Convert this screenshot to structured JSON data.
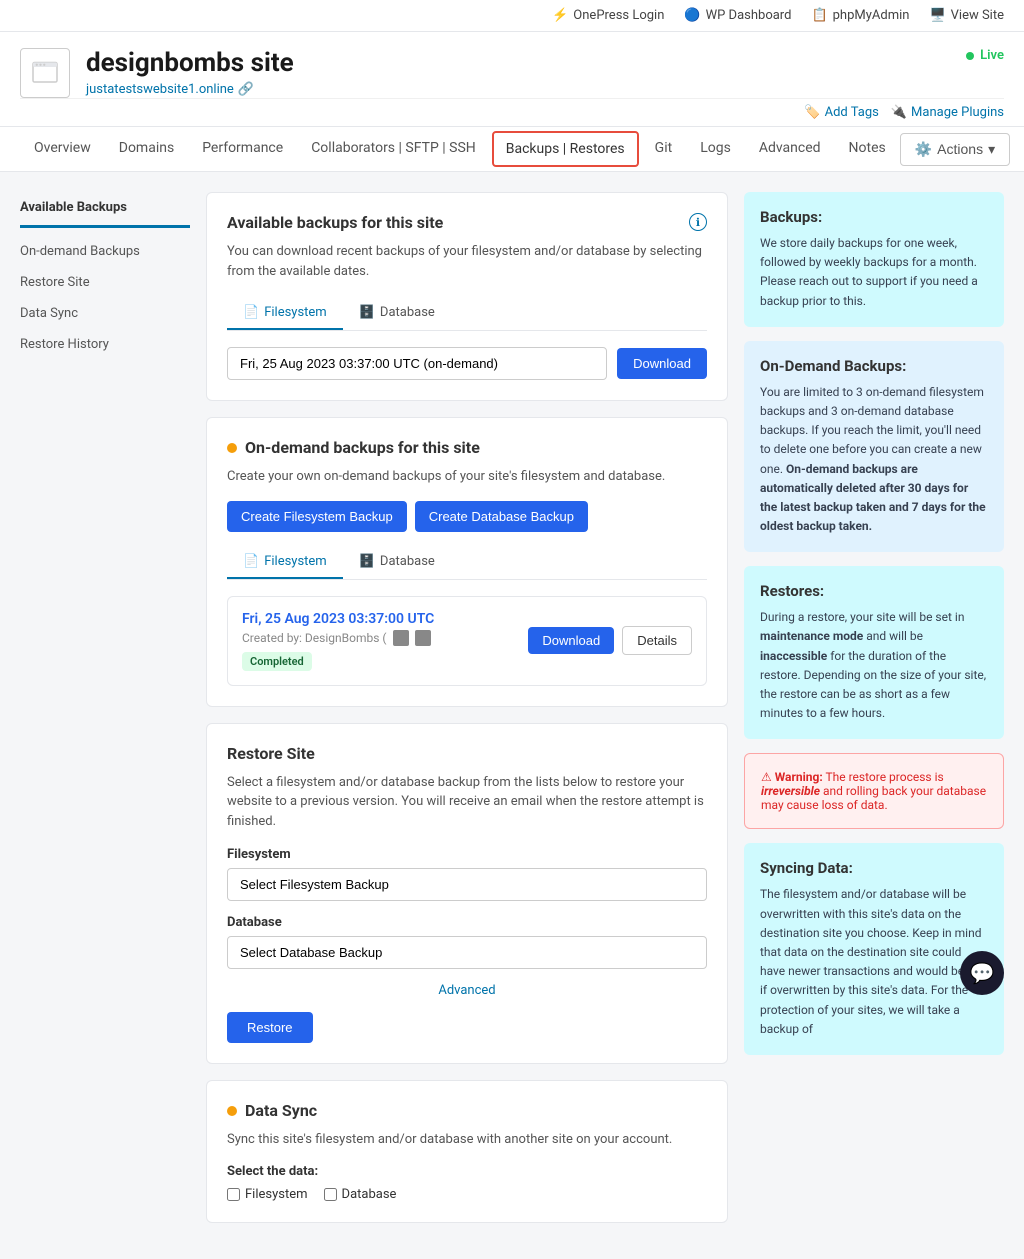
{
  "topbar": {
    "items": [
      {
        "id": "onepress-login",
        "label": "OnePress Login",
        "icon": "⚡"
      },
      {
        "id": "wp-dashboard",
        "label": "WP Dashboard",
        "icon": "🔵"
      },
      {
        "id": "phpmyadmin",
        "label": "phpMyAdmin",
        "icon": "📋"
      },
      {
        "id": "view-site",
        "label": "View Site",
        "icon": "🖥️"
      }
    ]
  },
  "siteHeader": {
    "name": "designbombs site",
    "url": "justatestswebsite1.online",
    "status": "Live",
    "actions": [
      {
        "id": "add-tags",
        "label": "Add Tags"
      },
      {
        "id": "manage-plugins",
        "label": "Manage Plugins"
      }
    ]
  },
  "nav": {
    "tabs": [
      {
        "id": "overview",
        "label": "Overview",
        "active": false
      },
      {
        "id": "domains",
        "label": "Domains",
        "active": false
      },
      {
        "id": "performance",
        "label": "Performance",
        "active": false
      },
      {
        "id": "collaborators",
        "label": "Collaborators | SFTP | SSH",
        "active": false
      },
      {
        "id": "backups-restores",
        "label": "Backups | Restores",
        "active": true,
        "highlighted": true
      },
      {
        "id": "git",
        "label": "Git",
        "active": false
      },
      {
        "id": "logs",
        "label": "Logs",
        "active": false
      },
      {
        "id": "advanced",
        "label": "Advanced",
        "active": false
      },
      {
        "id": "notes",
        "label": "Notes",
        "active": false
      }
    ],
    "actions_label": "Actions"
  },
  "sidebar": {
    "title": "Available Backups",
    "items": [
      {
        "id": "on-demand-backups",
        "label": "On-demand Backups"
      },
      {
        "id": "restore-site",
        "label": "Restore Site"
      },
      {
        "id": "data-sync",
        "label": "Data Sync"
      },
      {
        "id": "restore-history",
        "label": "Restore History"
      }
    ]
  },
  "availableBackups": {
    "title": "Available backups for this site",
    "description": "You can download recent backups of your filesystem and/or database by selecting from the available dates.",
    "tabs": [
      {
        "id": "filesystem",
        "label": "Filesystem",
        "icon": "📄",
        "active": true
      },
      {
        "id": "database",
        "label": "Database",
        "icon": "🗄️",
        "active": false
      }
    ],
    "selectedBackup": "Fri, 25 Aug 2023 03:37:00 UTC (on-demand)",
    "download_label": "Download"
  },
  "onDemandBackups": {
    "title": "On-demand backups for this site",
    "description": "Create your own on-demand backups of your site's filesystem and database.",
    "create_filesystem_label": "Create Filesystem Backup",
    "create_database_label": "Create Database Backup",
    "tabs": [
      {
        "id": "filesystem",
        "label": "Filesystem",
        "icon": "📄",
        "active": true
      },
      {
        "id": "database",
        "label": "Database",
        "icon": "🗄️",
        "active": false
      }
    ],
    "backup": {
      "date": "Fri, 25 Aug 2023 03:37:00 UTC",
      "created_by": "Created by: DesignBombs (",
      "status": "Completed",
      "download_label": "Download",
      "details_label": "Details"
    }
  },
  "restoreSite": {
    "title": "Restore Site",
    "description": "Select a filesystem and/or database backup from the lists below to restore your website to a previous version. You will receive an email when the restore attempt is finished.",
    "filesystem_label": "Filesystem",
    "filesystem_placeholder": "Select Filesystem Backup",
    "database_label": "Database",
    "database_placeholder": "Select Database Backup",
    "advanced_label": "Advanced",
    "restore_label": "Restore"
  },
  "dataSync": {
    "title": "Data Sync",
    "description": "Sync this site's filesystem and/or database with another site on your account.",
    "select_data_label": "Select the data:",
    "filesystem_label": "Filesystem",
    "database_label": "Database"
  },
  "infoCards": {
    "backups": {
      "title": "Backups:",
      "text": "We store daily backups for one week, followed by weekly backups for a month. Please reach out to support if you need a backup prior to this."
    },
    "onDemand": {
      "title": "On-Demand Backups:",
      "text": "You are limited to 3 on-demand filesystem backups and 3 on-demand database backups. If you reach the limit, you'll need to delete one before you can create a new one. On-demand backups are automatically deleted after 30 days for the latest backup taken and 7 days for the oldest backup taken."
    },
    "restores": {
      "title": "Restores:",
      "text": "During a restore, your site will be set in maintenance mode and will be inaccessible for the duration of the restore. Depending on the size of your site, the restore can be as short as a few minutes to a few hours."
    },
    "warning": {
      "text": "Warning: The restore process is irreversible and rolling back your database may cause loss of data."
    },
    "syncingData": {
      "title": "Syncing Data:",
      "text": "The filesystem and/or database will be overwritten with this site's data on the destination site you choose. Keep in mind that data on the destination site could have newer transactions and would be lost if overwritten by this site's data. For the protection of your sites, we will take a backup of"
    }
  }
}
